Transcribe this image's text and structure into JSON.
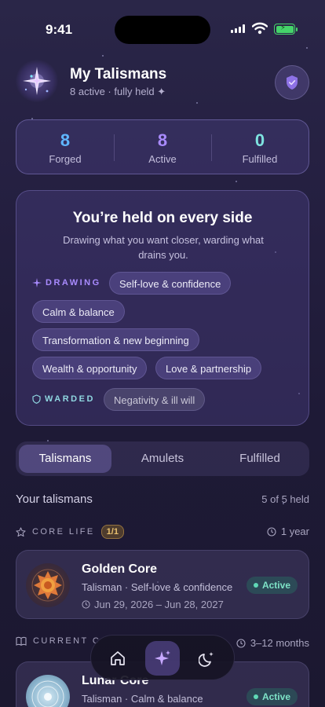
{
  "status_bar": {
    "time": "9:41"
  },
  "header": {
    "title": "My Talismans",
    "subtitle": "8 active · fully held ✦"
  },
  "stats": [
    {
      "value": "8",
      "label": "Forged",
      "color": "#5fb6ff"
    },
    {
      "value": "8",
      "label": "Active",
      "color": "#a98bff"
    },
    {
      "value": "0",
      "label": "Fulfilled",
      "color": "#7ee3e0"
    }
  ],
  "summary": {
    "title": "You’re held on every side",
    "subtitle": "Drawing what you want closer, warding what drains you.",
    "drawing_label": "DRAWING",
    "warded_label": "WARDED",
    "drawing_chips": [
      "Self-love & confidence",
      "Calm & balance",
      "Transformation & new beginning",
      "Wealth & opportunity",
      "Love & partnership"
    ],
    "warded_chips": [
      "Negativity & ill will"
    ]
  },
  "tabs": [
    {
      "label": "Talismans",
      "active": true
    },
    {
      "label": "Amulets",
      "active": false
    },
    {
      "label": "Fulfilled",
      "active": false
    }
  ],
  "section": {
    "title": "Your talismans",
    "count": "5 of 5 held"
  },
  "groups": [
    {
      "label": "CORE LIFE",
      "badge": "1/1",
      "duration": "1 year"
    },
    {
      "label": "CURRENT C",
      "duration": "3–12 months"
    }
  ],
  "cards": [
    {
      "name": "Golden Core",
      "meta": "Talisman · Self-love & confidence",
      "dates": "Jun 29, 2026 – Jun 28, 2027",
      "status": "Active"
    },
    {
      "name": "Lunar Core",
      "meta": "Talisman · Calm & balance",
      "status": "Active"
    }
  ],
  "nav": [
    {
      "icon": "home-icon"
    },
    {
      "icon": "sparkle-icon",
      "active": true
    },
    {
      "icon": "moon-stars-icon"
    }
  ]
}
